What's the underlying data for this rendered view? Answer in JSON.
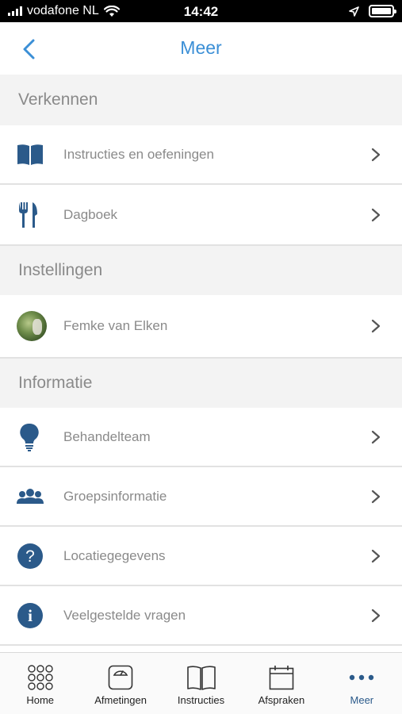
{
  "status": {
    "carrier": "vodafone NL",
    "time": "14:42",
    "battery_level": 1.0
  },
  "nav": {
    "title": "Meer"
  },
  "sections": [
    {
      "header": "Verkennen",
      "items": [
        {
          "label": "Instructies en oefeningen",
          "icon": "book-icon"
        },
        {
          "label": "Dagboek",
          "icon": "fork-knife-icon"
        }
      ]
    },
    {
      "header": "Instellingen",
      "items": [
        {
          "label": "Femke van Elken",
          "icon": "avatar"
        }
      ]
    },
    {
      "header": "Informatie",
      "items": [
        {
          "label": "Behandelteam",
          "icon": "lightbulb-icon"
        },
        {
          "label": "Groepsinformatie",
          "icon": "group-icon"
        },
        {
          "label": "Locatiegegevens",
          "icon": "question-icon"
        },
        {
          "label": "Veelgestelde vragen",
          "icon": "info-icon"
        }
      ]
    }
  ],
  "tabs": [
    {
      "label": "Home",
      "icon": "grid-dots-icon"
    },
    {
      "label": "Afmetingen",
      "icon": "scale-icon"
    },
    {
      "label": "Instructies",
      "icon": "book-outline-icon"
    },
    {
      "label": "Afspraken",
      "icon": "calendar-icon"
    },
    {
      "label": "Meer",
      "icon": "more-icon",
      "active": true
    }
  ],
  "colors": {
    "accent": "#3b8fd6",
    "icon_blue": "#2b5a8a",
    "label_gray": "#8a8a8a",
    "section_bg": "#f3f3f3"
  }
}
